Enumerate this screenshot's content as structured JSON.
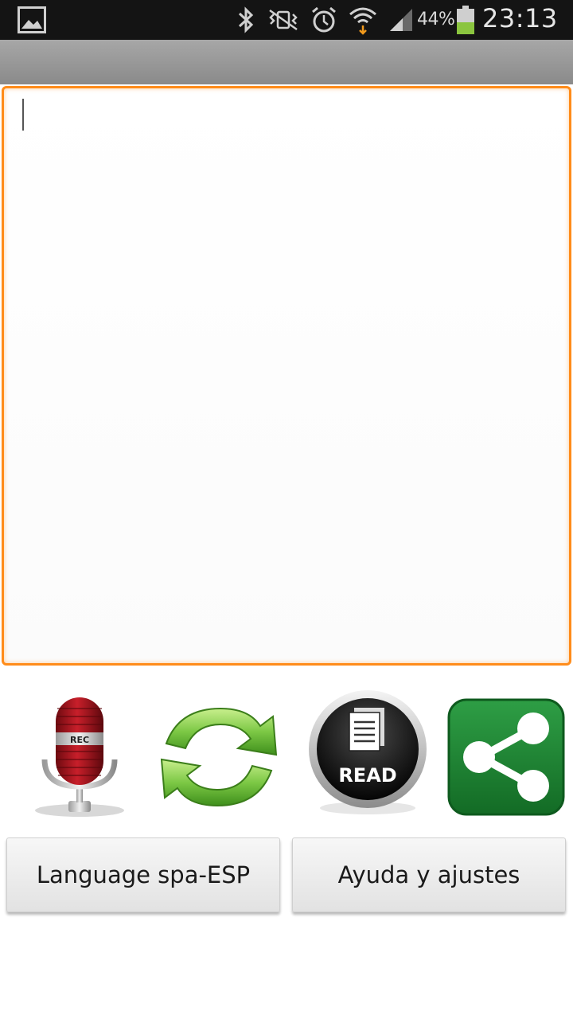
{
  "status_bar": {
    "battery_percent": "44%",
    "time": "23:13",
    "icons": [
      "gallery-icon",
      "bluetooth-icon",
      "vibrate-icon",
      "alarm-icon",
      "wifi-icon",
      "signal-icon",
      "battery-icon"
    ]
  },
  "editor": {
    "text": ""
  },
  "actions": {
    "mic_label": "REC",
    "read_label": "READ"
  },
  "buttons": {
    "language": "Language spa-ESP",
    "help": "Ayuda y ajustes"
  },
  "colors": {
    "accent_orange": "#ff8c1a",
    "status_bar": "#141414",
    "share_green": "#1f8a34",
    "refresh_green": "#7cc845",
    "mic_red": "#a3131d"
  }
}
